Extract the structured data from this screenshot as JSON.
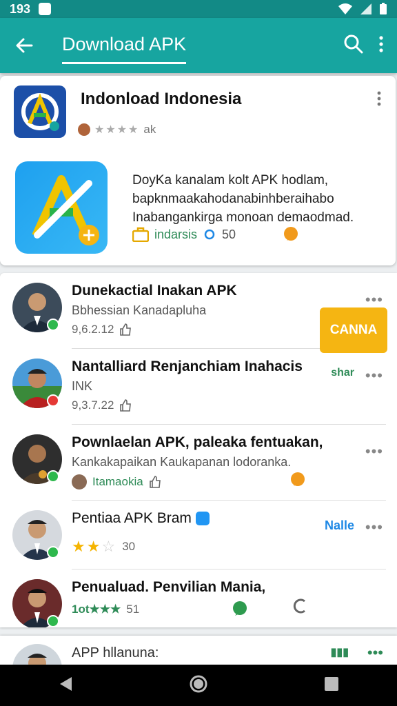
{
  "status": {
    "time": "193"
  },
  "appbar": {
    "title": "Download APK"
  },
  "featured": {
    "title": "Indonload Indonesia",
    "rating_text": "ak",
    "description": "DoyKa kanalam kolt APK hodlam, bapknmaakahodanabinhberaihabo Inabangankirga monoan demaodmad.",
    "tag_label": "indarsis",
    "tag_count": "50"
  },
  "list": [
    {
      "title": "Dunekactial Inakan APK",
      "subtitle": "Bbhessian Kanadapluha",
      "meta": "9,6.2.12",
      "side": "",
      "avatar_color": "#3c4b5a"
    },
    {
      "title": "Nantalliard Renjanchiam Inahacis",
      "subtitle": "INK",
      "meta": "9,3.7.22",
      "side": "shar",
      "avatar_color": "#8a2d2d"
    },
    {
      "title": "Pownlaelan APK, paleaka fentuakan,",
      "subtitle": "Kankakapaikan Kaukapanan lodoranka.",
      "meta": "Itamaokia",
      "side": "",
      "avatar_color": "#3a3a3a"
    },
    {
      "title": "Pentiaa APK Bram",
      "subtitle": "",
      "meta": "30",
      "side": "Nalle",
      "avatar_color": "#2b3c52"
    },
    {
      "title": "Penualuad. Penvilian Mania,",
      "subtitle": "",
      "meta": "51",
      "meta_prefix": "1ot★★★",
      "side": "",
      "avatar_color": "#5a2b2b"
    }
  ],
  "cta": {
    "label": "CANNA"
  },
  "peek": {
    "title": "APP hllanuna:"
  }
}
